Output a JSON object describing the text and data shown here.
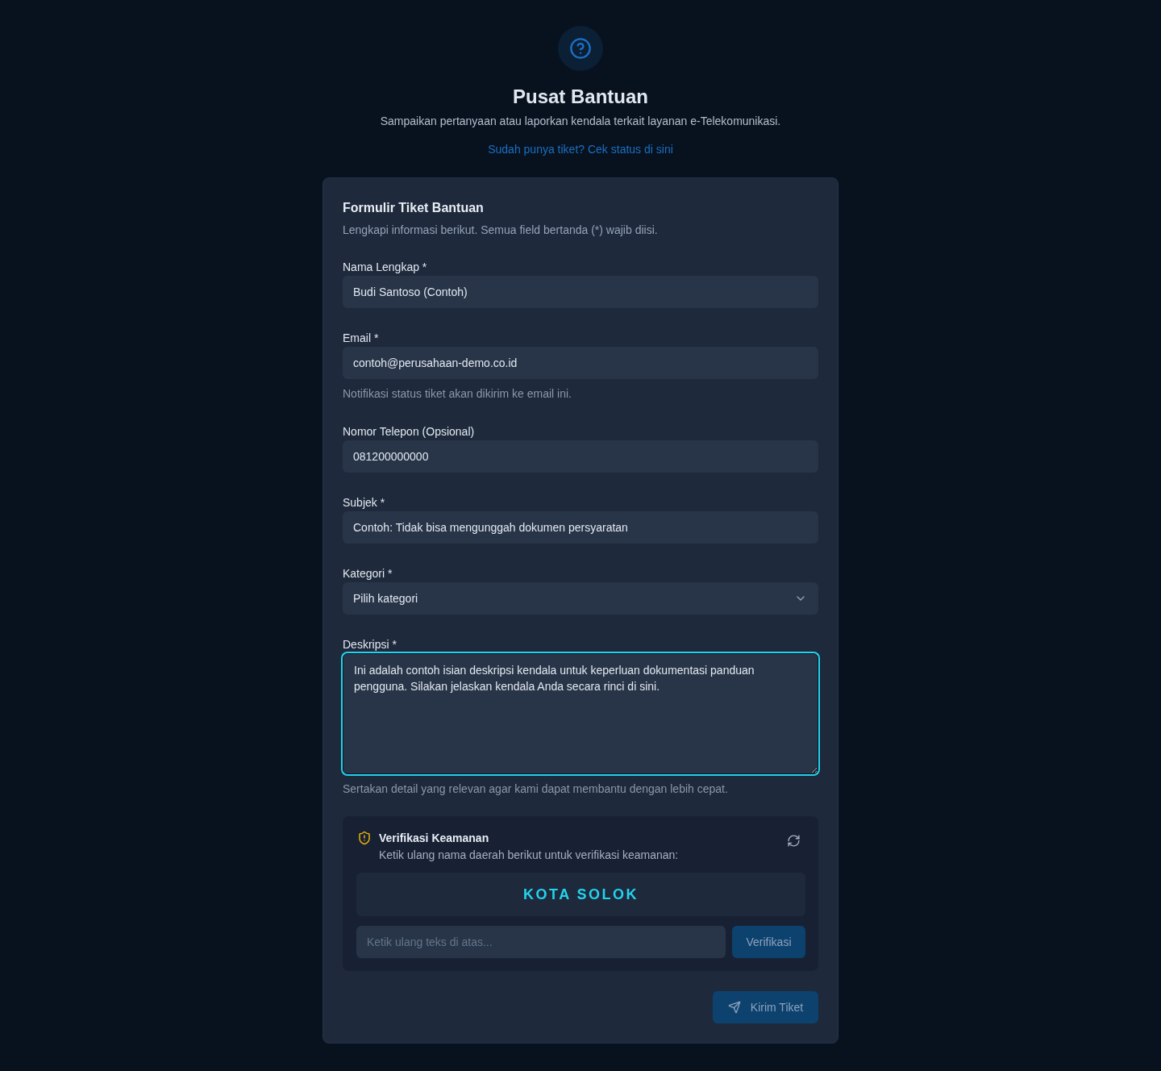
{
  "header": {
    "title": "Pusat Bantuan",
    "subtitle": "Sampaikan pertanyaan atau laporkan kendala terkait layanan e-Telekomunikasi.",
    "link": "Sudah punya tiket? Cek status di sini"
  },
  "form": {
    "title": "Formulir Tiket Bantuan",
    "subtitle": "Lengkapi informasi berikut. Semua field bertanda (*) wajib diisi.",
    "fields": [
      {
        "kind": "input",
        "label": "Nama Lengkap *",
        "value": "Budi Santoso (Contoh)",
        "focused": false
      },
      {
        "kind": "input",
        "label": "Email *",
        "value": "contoh@perusahaan-demo.co.id",
        "hint": "Notifikasi status tiket akan dikirim ke email ini.",
        "focused": false
      },
      {
        "kind": "input",
        "label": "Nomor Telepon (Opsional)",
        "value": "081200000000",
        "focused": false
      },
      {
        "kind": "input",
        "label": "Subjek *",
        "value": "Contoh: Tidak bisa mengunggah dokumen persyaratan",
        "focused": false
      },
      {
        "kind": "select",
        "label": "Kategori *",
        "value": "Pilih kategori",
        "focused": false
      },
      {
        "kind": "textarea",
        "label": "Deskripsi *",
        "value": "Ini adalah contoh isian deskripsi kendala untuk keperluan dokumentasi panduan pengguna. Silakan jelaskan kendala Anda secara rinci di sini.",
        "hint": "Sertakan detail yang relevan agar kami dapat membantu dengan lebih cepat.",
        "focused": true
      }
    ]
  },
  "verification": {
    "title": "Verifikasi Keamanan",
    "subtitle": "Ketik ulang nama daerah berikut untuk verifikasi keamanan:",
    "code": "KOTA SOLOK",
    "input": {
      "placeholder": "Ketik ulang teks di atas..."
    },
    "button": {
      "label": "Verifikasi",
      "disabled": true
    }
  },
  "submit": {
    "label": "Kirim Tiket",
    "disabled": true
  }
}
